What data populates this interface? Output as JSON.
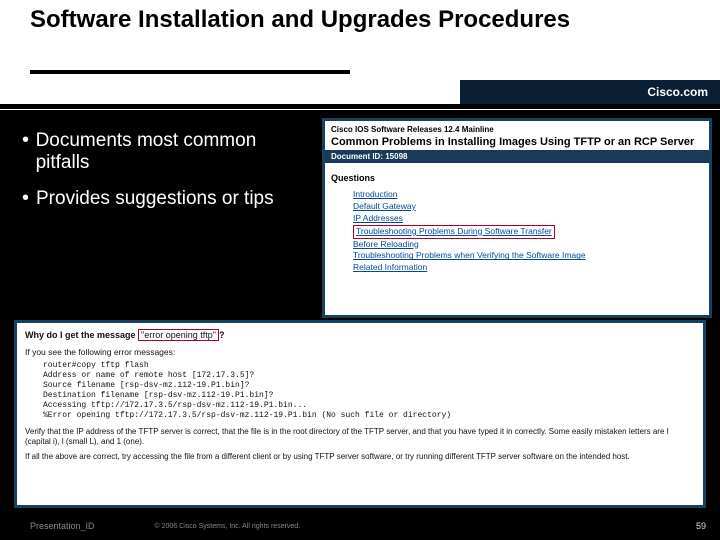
{
  "header": {
    "title": "Software Installation and Upgrades Procedures",
    "brand": "Cisco.com"
  },
  "bullets": [
    "Documents most common pitfalls",
    "Provides suggestions or tips"
  ],
  "doc_panel": {
    "top_line": "Cisco IOS Software Releases 12.4 Mainline",
    "title": "Common Problems in Installing Images Using TFTP or an RCP Server",
    "doc_id_label": "Document ID: 15098",
    "questions_label": "Questions",
    "links": [
      "Introduction",
      "Default Gateway",
      "IP Addresses",
      "Troubleshooting Problems During Software Transfer",
      "Before Reloading",
      "Troubleshooting Problems when Verifying the Software Image",
      "Related Information"
    ],
    "highlight_index": 3
  },
  "snippet": {
    "question_prefix": "Why do I get the message",
    "question_highlight": "\"error opening tftp\"",
    "question_suffix": "?",
    "lead": "If you see the following error messages:",
    "code": "router#copy tftp flash\nAddress or name of remote host [172.17.3.5]?\nSource filename [rsp-dsv-mz.112-19.P1.bin]?\nDestination filename [rsp-dsv-mz.112-19.P1.bin]?\nAccessing tftp://172.17.3.5/rsp-dsv-mz.112-19.P1.bin...\n%Error opening tftp://172.17.3.5/rsp-dsv-mz.112-19.P1.bin (No such file or directory)",
    "para1": "Verify that the IP address of the TFTP server is correct, that the file is in the root directory of the TFTP server, and that you have typed it in correctly. Some easily mistaken letters are I (capital i), l (small L), and 1 (one).",
    "para2": "If all the above are correct, try accessing the file from a different client or by using TFTP server software, or try running different TFTP server software on the intended host."
  },
  "footer": {
    "presentation_id": "Presentation_ID",
    "copyright": "© 2006 Cisco Systems, Inc. All rights reserved.",
    "page": "59"
  }
}
